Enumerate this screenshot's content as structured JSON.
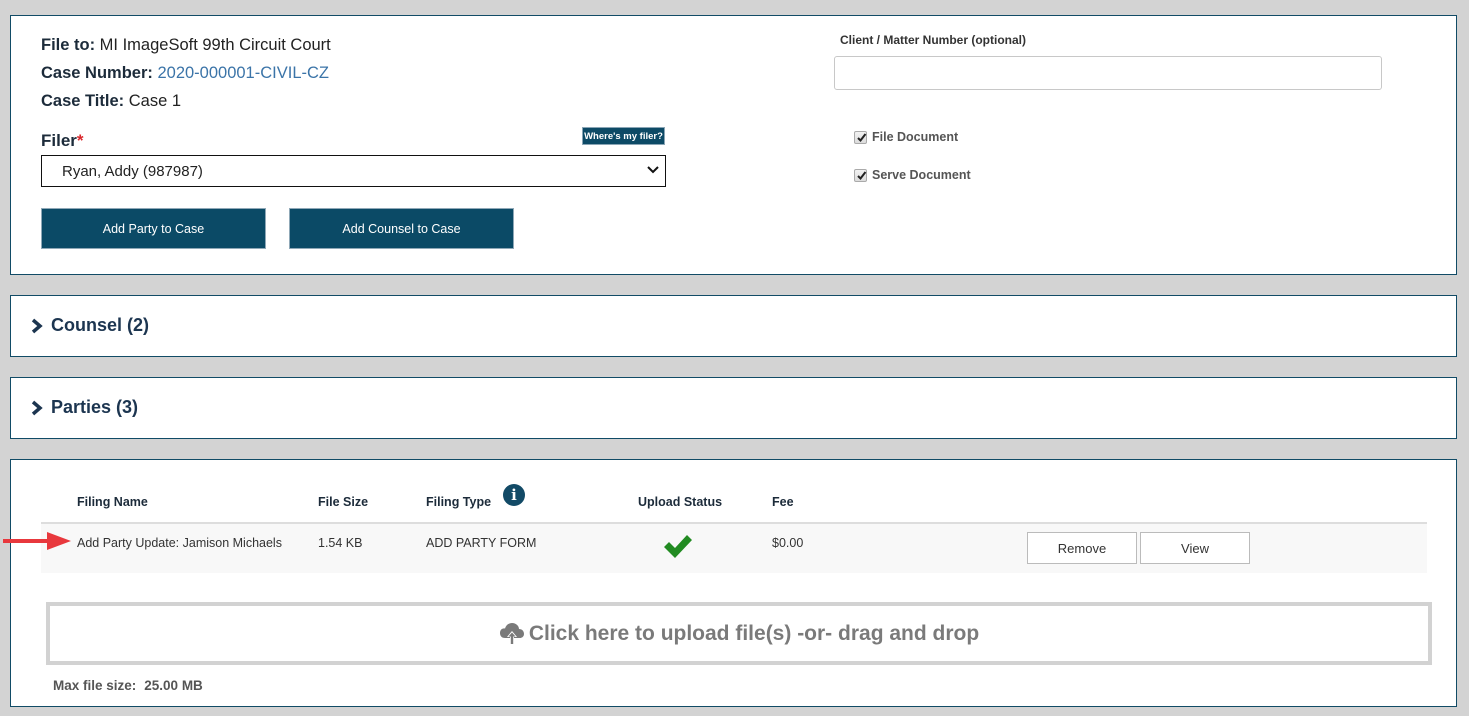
{
  "case_info": {
    "file_to_label": "File to:",
    "file_to_value": "MI ImageSoft 99th Circuit Court",
    "case_number_label": "Case Number:",
    "case_number_value": "2020-000001-CIVIL-CZ",
    "case_title_label": "Case Title:",
    "case_title_value": "Case 1"
  },
  "filer": {
    "label": "Filer",
    "required_mark": "*",
    "help_button": "Where's my filer?",
    "selected": "Ryan, Addy (987987)"
  },
  "actions": {
    "add_party": "Add Party to Case",
    "add_counsel": "Add Counsel to Case"
  },
  "client_matter": {
    "label": "Client / Matter Number (optional)",
    "value": "",
    "placeholder": ""
  },
  "options": {
    "file_document": {
      "label": "File Document",
      "checked": true
    },
    "serve_document": {
      "label": "Serve Document",
      "checked": true
    }
  },
  "sections": {
    "counsel": "Counsel (2)",
    "parties": "Parties (3)"
  },
  "filings": {
    "columns": [
      "Filing Name",
      "File Size",
      "Filing Type",
      "Upload Status",
      "Fee"
    ],
    "rows": [
      {
        "name": "Add Party Update: Jamison Michaels",
        "size": "1.54 KB",
        "type": "ADD PARTY FORM",
        "status": "uploaded",
        "fee": "$0.00",
        "remove_label": "Remove",
        "view_label": "View"
      }
    ]
  },
  "upload": {
    "prompt": "Click here to upload file(s) -or- drag and drop",
    "max_size_label": "Max file size:",
    "max_size_value": "25.00 MB"
  },
  "colors": {
    "primary": "#0b4a66",
    "link": "#3b74a8",
    "required": "#d9262a",
    "success": "#228b22",
    "annotation": "#e8383d"
  }
}
